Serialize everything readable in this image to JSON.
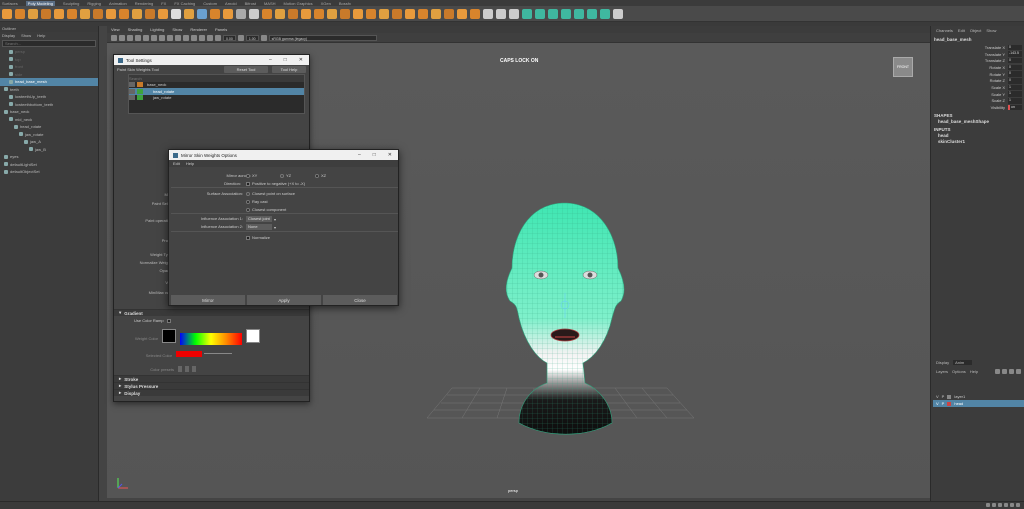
{
  "menubar": {
    "items": [
      "Surfaces",
      "Poly Modeling",
      "Sculpting",
      "Rigging",
      "Animation",
      "Rendering",
      "FX",
      "FX Caching",
      "Custom",
      "Arnold",
      "Bifrost",
      "MASH",
      "Motion Graphics",
      "XGen",
      "Bossfx"
    ],
    "active": "Poly Modeling"
  },
  "outliner": {
    "title": "Outliner",
    "menus": [
      "Display",
      "Show",
      "Help"
    ],
    "search_placeholder": "Search...",
    "rows": [
      {
        "label": "persp",
        "depth": 1,
        "state": "dim"
      },
      {
        "label": "top",
        "depth": 1,
        "state": "dim"
      },
      {
        "label": "front",
        "depth": 1,
        "state": "dim"
      },
      {
        "label": "side",
        "depth": 1,
        "state": "dim"
      },
      {
        "label": "head_base_mesh",
        "depth": 1,
        "state": "sel"
      },
      {
        "label": "teeth",
        "depth": 0,
        "state": ""
      },
      {
        "label": "lowteethUp_teeth",
        "depth": 1,
        "state": ""
      },
      {
        "label": "lowteethbottom_teeth",
        "depth": 1,
        "state": ""
      },
      {
        "label": "base_neck",
        "depth": 0,
        "state": ""
      },
      {
        "label": "mid_neck",
        "depth": 1,
        "state": ""
      },
      {
        "label": "head_rotate",
        "depth": 2,
        "state": ""
      },
      {
        "label": "jaw_rotate",
        "depth": 3,
        "state": ""
      },
      {
        "label": "jaw_A",
        "depth": 4,
        "state": ""
      },
      {
        "label": "jaw_B",
        "depth": 5,
        "state": ""
      },
      {
        "label": "eyes",
        "depth": 0,
        "state": ""
      },
      {
        "label": "defaultLightSet",
        "depth": 0,
        "state": ""
      },
      {
        "label": "defaultObjectSet",
        "depth": 0,
        "state": ""
      }
    ]
  },
  "viewport": {
    "menus": [
      "View",
      "Shading",
      "Lighting",
      "Show",
      "Renderer",
      "Panels"
    ],
    "field_a": "0.00",
    "field_b": "1.00",
    "colorspace": "sRGB gamma (legacy)",
    "caps_lock": "CAPS LOCK ON",
    "view_cube": "FRONT",
    "camera": "persp"
  },
  "channelbox": {
    "tabs": [
      "Channels",
      "Edit",
      "Object",
      "Show"
    ],
    "object": "head_base_mesh",
    "channels": [
      {
        "label": "Translate X",
        "value": "0"
      },
      {
        "label": "Translate Y",
        "value": "-143.5"
      },
      {
        "label": "Translate Z",
        "value": "0"
      },
      {
        "label": "Rotate X",
        "value": "0"
      },
      {
        "label": "Rotate Y",
        "value": "0"
      },
      {
        "label": "Rotate Z",
        "value": "0"
      },
      {
        "label": "Scale X",
        "value": "1"
      },
      {
        "label": "Scale Y",
        "value": "1"
      },
      {
        "label": "Scale Z",
        "value": "1"
      },
      {
        "label": "Visibility",
        "value": "on"
      }
    ],
    "shapes_h": "SHAPES",
    "shape": "head_base_meshShape",
    "inputs_h": "INPUTS",
    "inputs": [
      "head",
      "skinCluster1"
    ]
  },
  "layers": {
    "tabs": [
      "Display",
      "Anim"
    ],
    "menus": [
      "Layers",
      "Options",
      "Help"
    ],
    "rows": [
      {
        "v": "V",
        "p": "P",
        "name": "layer1"
      },
      {
        "v": "V",
        "p": "P",
        "name": "head"
      }
    ]
  },
  "toolwin": {
    "title": "Tool Settings",
    "tool_name": "Paint Skin Weights Tool",
    "reset_label": "Reset Tool",
    "help_label": "Tool Help",
    "search_placeholder": "Search",
    "influences": [
      {
        "label": "base_neck",
        "color": "#c77a2a",
        "sel": false
      },
      {
        "label": "head_rotate",
        "color": "#3da33d",
        "sel": true
      },
      {
        "label": "jaw_rotate",
        "color": "#3da33d",
        "sel": false
      }
    ],
    "labels": {
      "mode": "Mo",
      "paint_select": "Paint Sele",
      "paint_ops": "Paint operatio",
      "profile": "Profi",
      "weight_type": "Weight Typ",
      "normalize": "Normalize Weigh",
      "opacity": "Opaci",
      "value": "Va",
      "minmax": "Min/Max val"
    },
    "gradient": "Gradient",
    "use_color_ramp": "Use Color Ramp",
    "weight_color": "Weight Color",
    "selected_color": "Selected Color",
    "color_presets": "Color presets",
    "sections": [
      "Stroke",
      "Stylus Pressure",
      "Display"
    ]
  },
  "mirror": {
    "title": "Mirror Skin Weights Options",
    "menus": [
      "Edit",
      "Help"
    ],
    "mirror_across_label": "Mirror across:",
    "axes": [
      {
        "label": "XY",
        "on": false
      },
      {
        "label": "YZ",
        "on": true
      },
      {
        "label": "XZ",
        "on": false
      }
    ],
    "direction_label": "Direction:",
    "direction_text": "Positive to negative (+X to -X)",
    "surface_label": "Surface Association:",
    "surface_options": [
      {
        "label": "Closest point on surface",
        "on": true
      },
      {
        "label": "Ray cast",
        "on": false
      },
      {
        "label": "Closest component",
        "on": false
      }
    ],
    "inf1_label": "Influence Association 1:",
    "inf1_value": "Closest joint",
    "inf2_label": "Influence Association 2:",
    "inf2_value": "None",
    "normalize_label": "Normalize",
    "btn_mirror": "Mirror",
    "btn_apply": "Apply",
    "btn_close": "Close"
  },
  "colors": {
    "selection": "#5285a6",
    "wire": "#4fe8b0",
    "skin": "#e8e8e8"
  }
}
